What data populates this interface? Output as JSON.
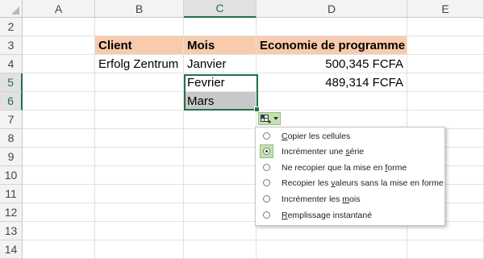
{
  "columns": [
    "A",
    "B",
    "C",
    "D",
    "E"
  ],
  "selected_column": "C",
  "rows": [
    "2",
    "3",
    "4",
    "5",
    "6",
    "7",
    "8",
    "9",
    "10",
    "11",
    "12",
    "13",
    "14"
  ],
  "selected_rows": [
    "5",
    "6"
  ],
  "headers": {
    "client": "Client",
    "mois": "Mois",
    "economie": "Economie de programme"
  },
  "data_rows": [
    {
      "client": "Erfolg Zentrum",
      "mois": "Janvier",
      "amount": "500,345 FCFA"
    },
    {
      "client": "",
      "mois": "Fevrier",
      "amount": "489,314 FCFA"
    },
    {
      "client": "",
      "mois": "Mars",
      "amount": ""
    }
  ],
  "colors": {
    "header_fill": "#f8cbad",
    "selection": "#217346",
    "highlight": "#c8c8c8",
    "option_button": "#c6e0b4"
  },
  "autofill_menu": {
    "icon": "autofill-options-icon",
    "items": [
      {
        "pre": "",
        "accel": "C",
        "post": "opier les cellules",
        "checked": false
      },
      {
        "pre": "Incrémenter une ",
        "accel": "s",
        "post": "érie",
        "checked": true
      },
      {
        "pre": "Ne recopier que la mise en ",
        "accel": "f",
        "post": "orme",
        "checked": false
      },
      {
        "pre": "Recopier les ",
        "accel": "v",
        "post": "aleurs sans la mise en forme",
        "checked": false
      },
      {
        "pre": "Incrémenter les ",
        "accel": "m",
        "post": "ois",
        "checked": false
      },
      {
        "pre": "",
        "accel": "R",
        "post": "emplissage instantané",
        "checked": false
      }
    ]
  }
}
